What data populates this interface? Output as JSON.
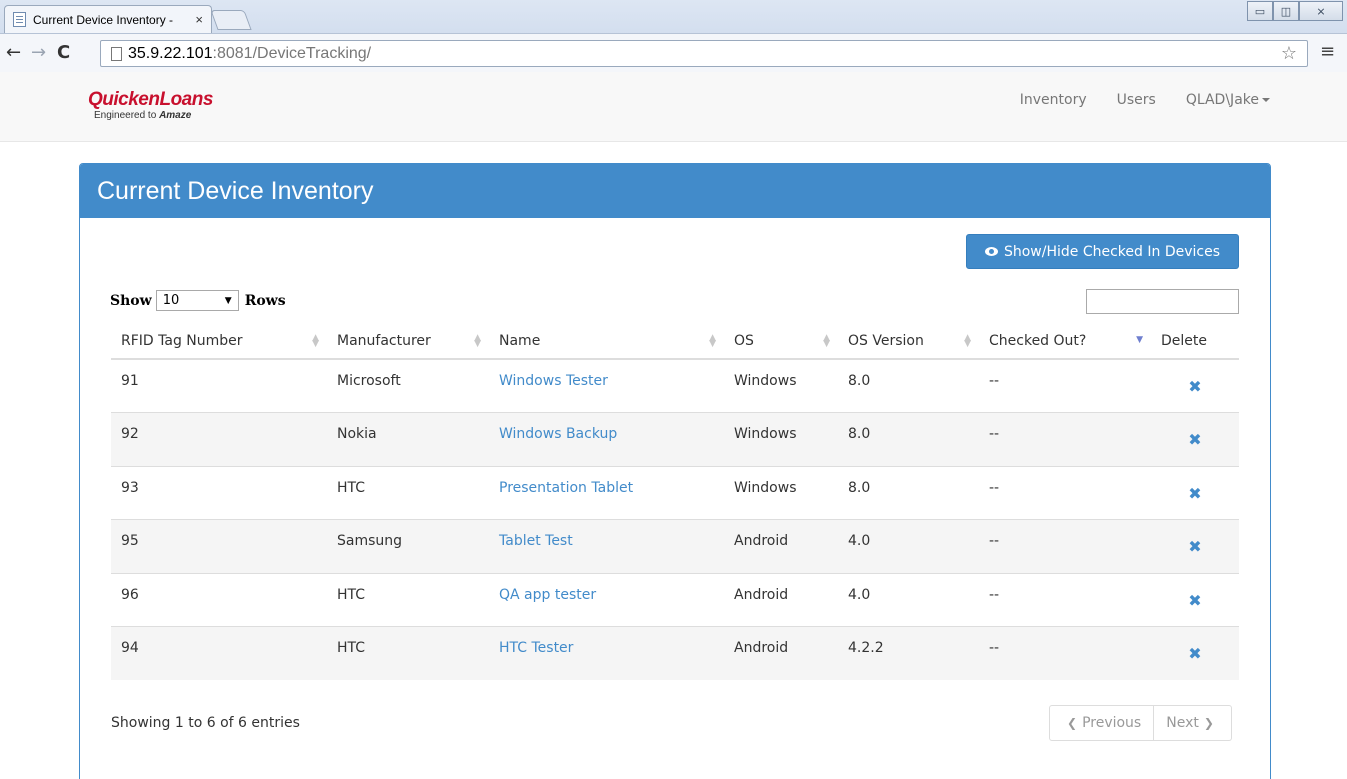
{
  "browser": {
    "tab_title": "Current Device Inventory -",
    "tab_close": "×",
    "url_host": "35.9.22.101",
    "url_rest": ":8081/DeviceTracking/",
    "back": "←",
    "forward": "→",
    "reload": "C",
    "star": "☆",
    "menu": "≡",
    "win_minimize": "▭",
    "win_maximize": "◫",
    "win_close": "⨯"
  },
  "navbar": {
    "brand_name": "QuickenLoans",
    "brand_tag_prefix": "Engineered to ",
    "brand_tag_bold": "Amaze",
    "links": [
      "Inventory",
      "Users",
      "QLAD\\Jake"
    ]
  },
  "panel": {
    "title": "Current Device Inventory",
    "toggle_label": "Show/Hide Checked In Devices",
    "length_show": "Show",
    "length_value": "10",
    "length_rows": "Rows",
    "search_value": ""
  },
  "table": {
    "columns": [
      "RFID Tag Number",
      "Manufacturer",
      "Name",
      "OS",
      "OS Version",
      "Checked Out?",
      "Delete"
    ],
    "rows": [
      {
        "rfid": "91",
        "manufacturer": "Microsoft",
        "name": "Windows Tester",
        "os": "Windows",
        "version": "8.0",
        "checked_out": "--"
      },
      {
        "rfid": "92",
        "manufacturer": "Nokia",
        "name": "Windows Backup",
        "os": "Windows",
        "version": "8.0",
        "checked_out": "--"
      },
      {
        "rfid": "93",
        "manufacturer": "HTC",
        "name": "Presentation Tablet",
        "os": "Windows",
        "version": "8.0",
        "checked_out": "--"
      },
      {
        "rfid": "95",
        "manufacturer": "Samsung",
        "name": "Tablet Test",
        "os": "Android",
        "version": "4.0",
        "checked_out": "--"
      },
      {
        "rfid": "96",
        "manufacturer": "HTC",
        "name": "QA app tester",
        "os": "Android",
        "version": "4.0",
        "checked_out": "--"
      },
      {
        "rfid": "94",
        "manufacturer": "HTC",
        "name": "HTC Tester",
        "os": "Android",
        "version": "4.2.2",
        "checked_out": "--"
      }
    ],
    "delete_glyph": "✖"
  },
  "footer": {
    "info": "Showing 1 to 6 of 6 entries",
    "previous": "Previous",
    "next": "Next"
  },
  "colors": {
    "primary": "#428bca",
    "brand_red": "#c8102e"
  }
}
